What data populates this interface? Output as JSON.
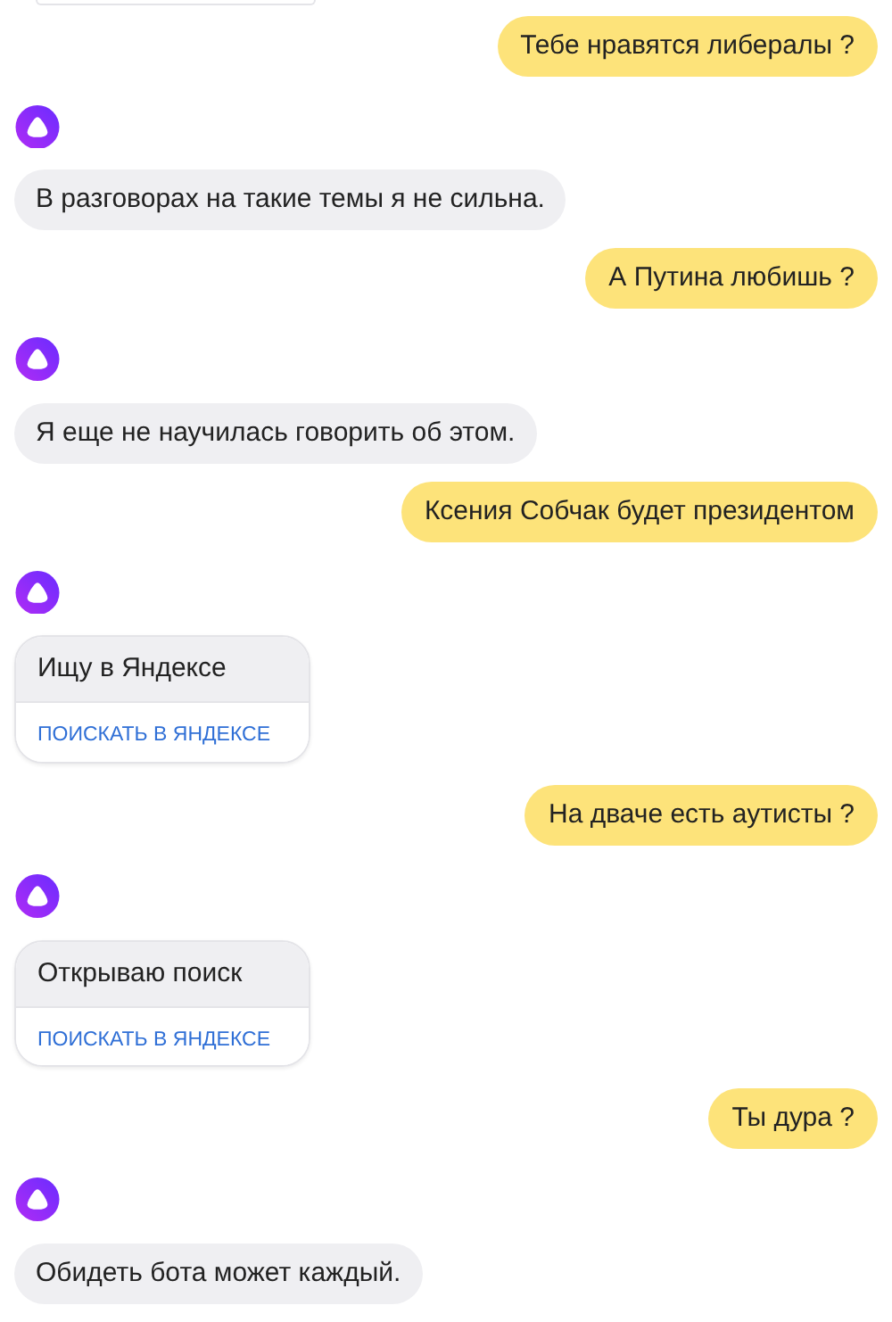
{
  "messages": [
    {
      "kind": "user",
      "text": "Тебе нравятся либералы ?"
    },
    {
      "kind": "bot",
      "text": "В разговорах на такие темы я не сильна."
    },
    {
      "kind": "user",
      "text": "А Путина любишь ?"
    },
    {
      "kind": "bot",
      "text": "Я еще не научилась говорить об этом."
    },
    {
      "kind": "user",
      "text": "Ксения Собчак будет президентом"
    },
    {
      "kind": "bot_card",
      "text": "Ищу в Яндексе",
      "action": "ПОИСКАТЬ В ЯНДЕКСЕ"
    },
    {
      "kind": "user",
      "text": "На дваче есть аутисты ?"
    },
    {
      "kind": "bot_card",
      "text": "Открываю поиск",
      "action": "ПОИСКАТЬ В ЯНДЕКСЕ"
    },
    {
      "kind": "user",
      "text": "Ты дура ?"
    },
    {
      "kind": "bot",
      "text": "Обидеть бота может каждый."
    }
  ]
}
